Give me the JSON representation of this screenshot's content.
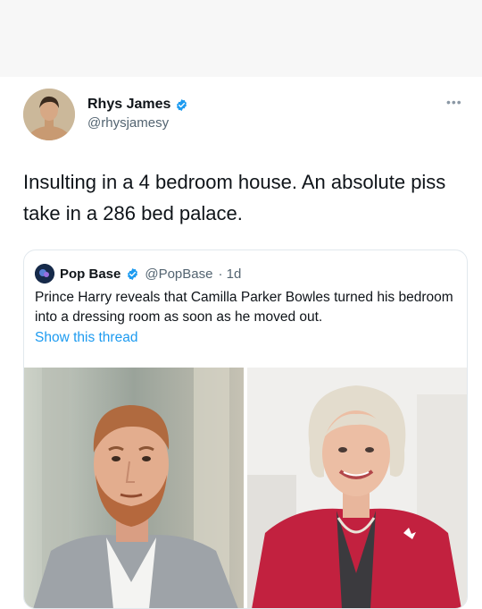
{
  "tweet": {
    "author_name": "Rhys James",
    "author_handle": "@rhysjamesy",
    "text": "Insulting in a 4 bedroom house. An absolute piss take in a 286 bed palace.",
    "more_icon": "more-horizontal-icon"
  },
  "quote": {
    "author_name": "Pop Base",
    "author_handle": "@PopBase",
    "age": "· 1d",
    "text": "Prince Harry reveals that Camilla Parker Bowles turned his bedroom into a dressing room as soon as he moved out.",
    "link_label": "Show this thread"
  },
  "colors": {
    "verified": "#1d9bf0",
    "link": "#1d9bf0",
    "text": "#0f1419",
    "muted": "#536471",
    "jacket_red": "#c2213f"
  }
}
